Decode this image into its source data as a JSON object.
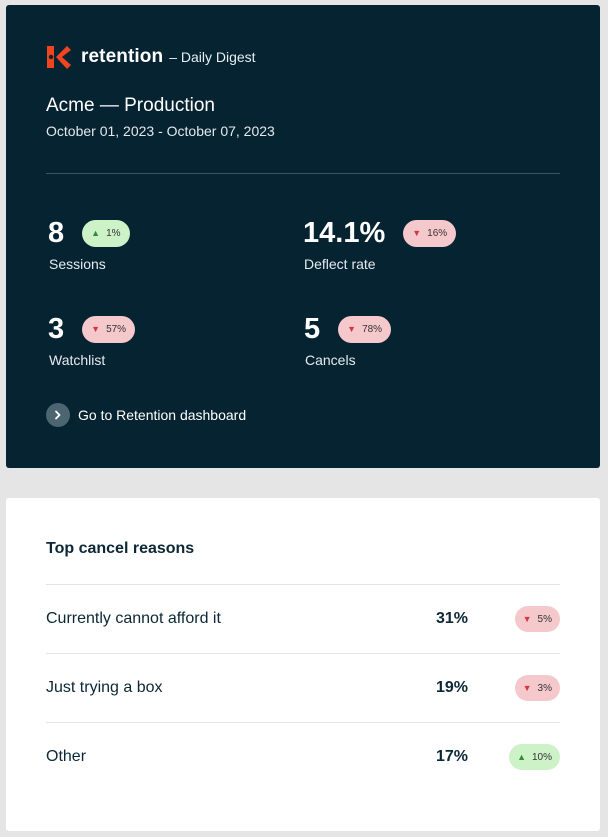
{
  "header": {
    "brand_name": "retention",
    "brand_suffix": "– Daily Digest",
    "project": "Acme — Production",
    "date_range": "October 01, 2023 - October 07, 2023"
  },
  "metrics": [
    {
      "value": "8",
      "label": "Sessions",
      "change": "1%",
      "direction": "up"
    },
    {
      "value": "14.1%",
      "label": "Deflect rate",
      "change": "16%",
      "direction": "down"
    },
    {
      "value": "3",
      "label": "Watchlist",
      "change": "57%",
      "direction": "down"
    },
    {
      "value": "5",
      "label": "Cancels",
      "change": "78%",
      "direction": "down"
    }
  ],
  "dashboard_link": {
    "label": "Go to Retention dashboard"
  },
  "cancel_reasons": {
    "title": "Top cancel reasons",
    "items": [
      {
        "label": "Currently cannot afford it",
        "percent": "31%",
        "change": "5%",
        "direction": "down"
      },
      {
        "label": "Just trying a box",
        "percent": "19%",
        "change": "3%",
        "direction": "down"
      },
      {
        "label": "Other",
        "percent": "17%",
        "change": "10%",
        "direction": "up"
      }
    ]
  },
  "icons": {
    "up_arrow": "▲",
    "down_arrow": "▼"
  },
  "colors": {
    "dark_panel": "#062331",
    "brand_orange": "#f0451e",
    "badge_up_bg": "#cdf2c8",
    "badge_down_bg": "#f5c9cc"
  }
}
